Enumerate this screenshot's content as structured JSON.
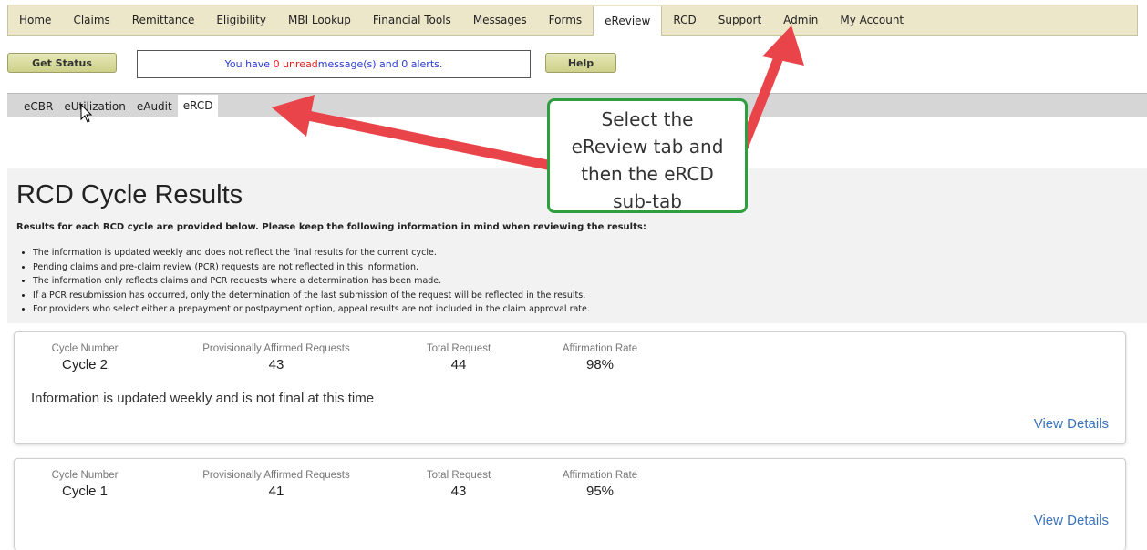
{
  "topnav": {
    "items": [
      "Home",
      "Claims",
      "Remittance",
      "Eligibility",
      "MBI Lookup",
      "Financial Tools",
      "Messages",
      "Forms",
      "eReview",
      "RCD",
      "Support",
      "Admin",
      "My Account"
    ],
    "active": "eReview"
  },
  "toolbar": {
    "get_status_label": "Get Status",
    "help_label": "Help",
    "message_prefix": "You have ",
    "unread_count": "0",
    "unread_text": " unread",
    "message_suffix": " message(s) and 0 alerts."
  },
  "subtabs": {
    "items": [
      "eCBR",
      "eUtilization",
      "eAudit",
      "eRCD"
    ],
    "active": "eRCD"
  },
  "page": {
    "title": "RCD Cycle Results",
    "intro": "Results for each RCD cycle are provided below. Please keep the following information in mind when reviewing the results:",
    "bullets": [
      "The information is updated weekly and does not reflect the final results for the current cycle.",
      "Pending claims and pre-claim review (PCR) requests are not reflected in this information.",
      "The information only reflects claims and PCR requests where a determination has been made.",
      "If a PCR resubmission has occurred, only the determination of the last submission of the request will be reflected in the results.",
      "For providers who select either a prepayment or postpayment option, appeal results are not included in the claim approval rate."
    ]
  },
  "labels": {
    "cycle_number": "Cycle Number",
    "affirmed": "Provisionally Affirmed Requests",
    "total": "Total Request",
    "rate": "Affirmation Rate",
    "view_details": "View Details"
  },
  "cycles": [
    {
      "cycle": "Cycle 2",
      "affirmed": "43",
      "total": "44",
      "rate": "98%",
      "note": "Information is updated weekly and is not final at this time"
    },
    {
      "cycle": "Cycle 1",
      "affirmed": "41",
      "total": "43",
      "rate": "95%"
    }
  ],
  "callout": {
    "lines": [
      "Select the",
      "eReview tab and",
      "then the eRCD",
      "sub-tab"
    ],
    "border_color": "#2e9e3e"
  },
  "colors": {
    "nav_bg": "#ede7ca",
    "link": "#3b73b9",
    "message": "#2a3ccf",
    "alert_red": "#e0231e",
    "arrow": "#e8444a"
  }
}
